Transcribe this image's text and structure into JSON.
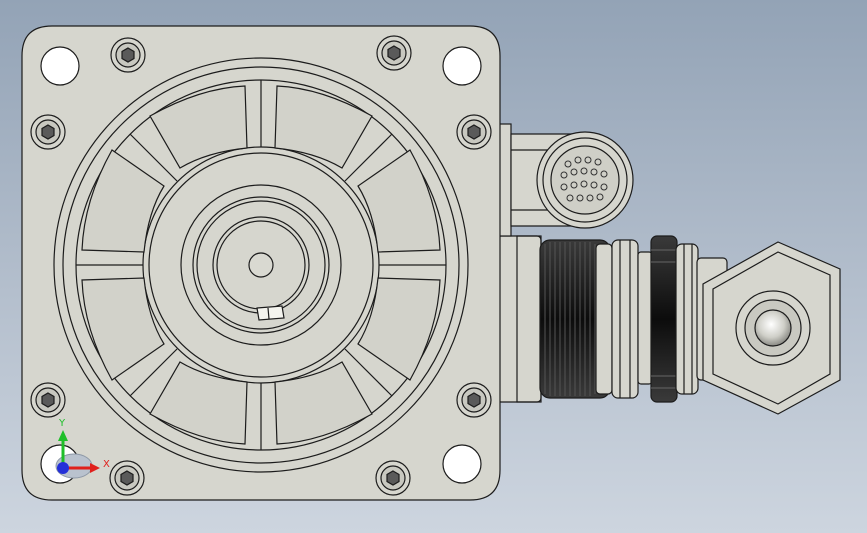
{
  "viewport": {
    "background_top": "#93a3b6",
    "background_bottom": "#cdd5df"
  },
  "model": {
    "body_color": "#d6d6ce",
    "line_color": "#1c1c1c",
    "connector_ring_color": "#1a1a1a"
  },
  "triad": {
    "x_label": "X",
    "y_label": "Y",
    "x_color": "#e0201c",
    "y_color": "#1fbf2a",
    "z_color": "#2430d8"
  }
}
